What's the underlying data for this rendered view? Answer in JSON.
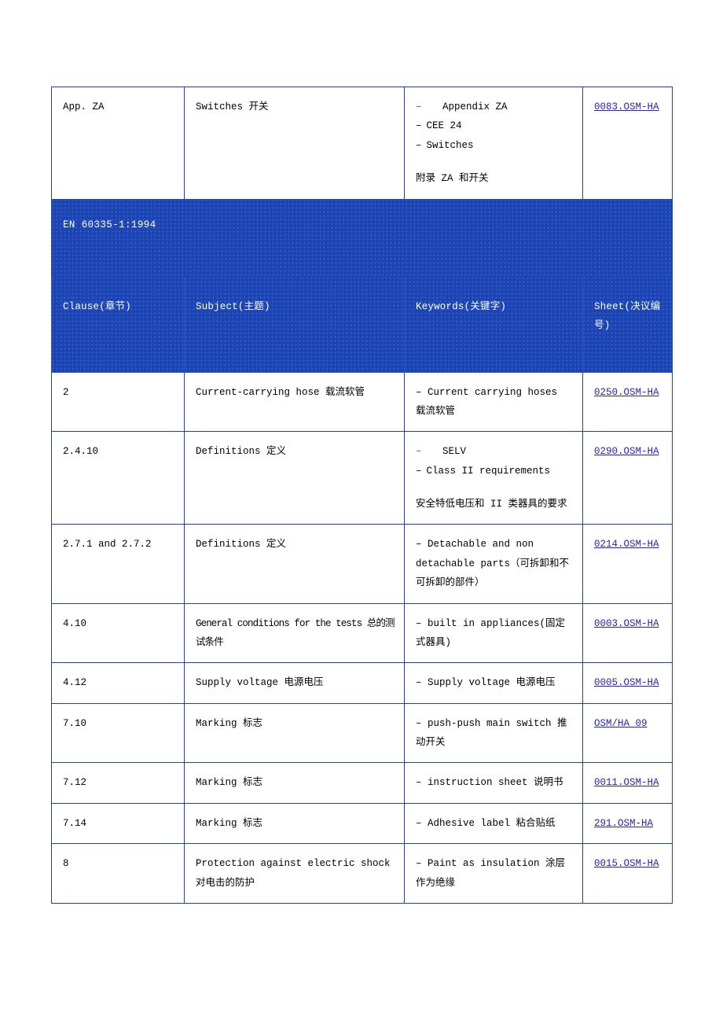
{
  "document": {
    "colors": {
      "header_blue": "#1B45B5",
      "border_blue": "#2040C0",
      "link_blue": "#2323CC",
      "text_black": "#000000",
      "page_background": "#FFFFFF"
    }
  },
  "top_row": {
    "clause": "App. ZA",
    "subject": "Switches 开关",
    "keywords": {
      "bullets": [
        {
          "dash": "–",
          "text": "Appendix ZA",
          "level": 1
        },
        {
          "dash": "–",
          "text": "CEE 24",
          "level": 2
        },
        {
          "dash": "–",
          "text": "Switches",
          "level": 2
        }
      ],
      "chinese": "附录 ZA 和开关"
    },
    "sheet": "0083.OSM-HA"
  },
  "section": {
    "title": "EN 60335-1:1994",
    "columns": {
      "clause": "Clause(章节)",
      "subject": "Subject(主题)",
      "keywords": "Keywords(关键字)",
      "sheet": "Sheet(决议编号)"
    }
  },
  "rows": [
    {
      "clause": "2",
      "subject": "Current-carrying hose 载流软管",
      "keywords_flat": "– Current carrying hoses 载流软管",
      "sheet": "0250.OSM-HA"
    },
    {
      "clause": "2.4.10",
      "subject": "Definitions 定义",
      "keywords": {
        "bullets": [
          {
            "dash": "–",
            "text": "SELV",
            "level": 1
          },
          {
            "dash": "–",
            "text": "Class II requirements",
            "level": 2
          }
        ],
        "chinese": "安全特低电压和 II 类器具的要求"
      },
      "sheet": "0290.OSM-HA"
    },
    {
      "clause": "2.7.1 and 2.7.2",
      "subject": "Definitions 定义",
      "keywords_flat": "– Detachable and non detachable parts（可拆卸和不可拆卸的部件）",
      "sheet": "0214.OSM-HA"
    },
    {
      "clause": "4.10",
      "subject": "General conditions for the tests 总的测试条件",
      "keywords_flat": "– built in appliances(固定式器具)",
      "sheet": "0003.OSM-HA"
    },
    {
      "clause": "4.12",
      "subject": "Supply voltage 电源电压",
      "keywords_flat": "– Supply voltage 电源电压",
      "sheet": "0005.OSM-HA"
    },
    {
      "clause": "7.10",
      "subject": "Marking 标志",
      "keywords_flat": "– push-push main switch 推动开关",
      "sheet": "OSM/HA 09"
    },
    {
      "clause": "7.12",
      "subject": "Marking 标志",
      "keywords_flat": "– instruction sheet 说明书",
      "sheet": "0011.OSM-HA"
    },
    {
      "clause": "7.14",
      "subject": "Marking 标志",
      "keywords_flat": "– Adhesive label 粘合贴纸",
      "sheet": "291.OSM-HA"
    },
    {
      "clause": "8",
      "subject": "Protection against electric shock 对电击的防护",
      "keywords_flat": "– Paint as insulation 涂层作为绝缘",
      "sheet": "0015.OSM-HA"
    }
  ]
}
